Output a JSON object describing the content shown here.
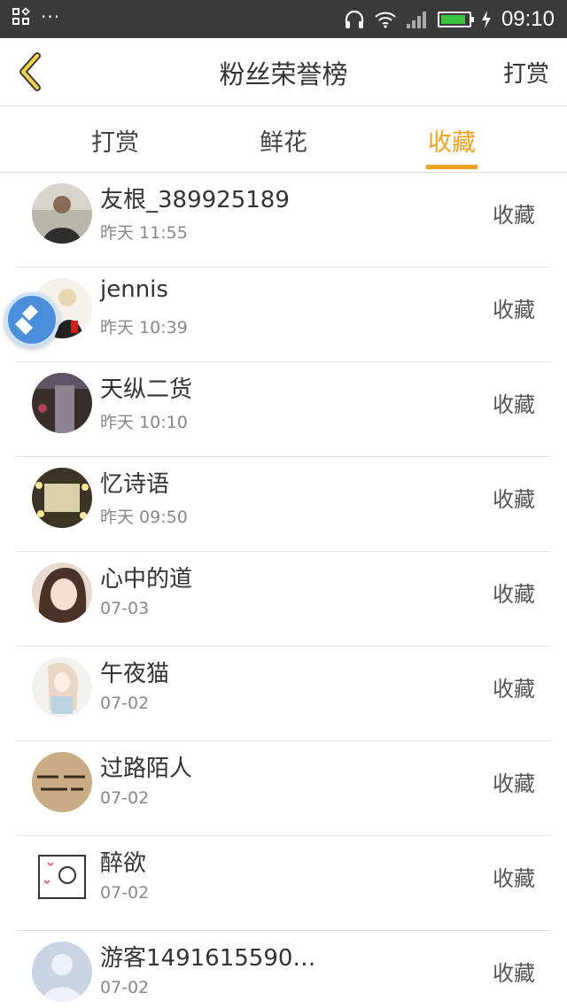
{
  "status_bar": {
    "time": "09:10",
    "dots": "···",
    "icons": [
      "grid-icon",
      "headphones-icon",
      "wifi-icon",
      "signal-icon",
      "battery-icon",
      "charging-icon"
    ],
    "battery_level": 0.9,
    "battery_color": "#3ec33e"
  },
  "header": {
    "back_icon": "chevron-left-icon",
    "title": "粉丝荣誉榜",
    "action": "打赏"
  },
  "tabs": [
    {
      "label": "打赏",
      "active": false
    },
    {
      "label": "鲜花",
      "active": false
    },
    {
      "label": "收藏",
      "active": true
    }
  ],
  "accent_color": "#f0a21f",
  "list": [
    {
      "name": "友根_389925189",
      "time": "昨天  11:55",
      "tag": "收藏"
    },
    {
      "name": "jennis",
      "time": "昨天  10:39",
      "tag": "收藏"
    },
    {
      "name": "天纵二货",
      "time": "昨天  10:10",
      "tag": "收藏"
    },
    {
      "name": "忆诗语",
      "time": "昨天  09:50",
      "tag": "收藏"
    },
    {
      "name": "心中的道",
      "time": "07-03",
      "tag": "收藏"
    },
    {
      "name": "午夜猫",
      "time": "07-02",
      "tag": "收藏"
    },
    {
      "name": "过路陌人",
      "time": "07-02",
      "tag": "收藏"
    },
    {
      "name": "醉欲",
      "time": "07-02",
      "tag": "收藏"
    },
    {
      "name": "游客1491615590…",
      "time": "07-02",
      "tag": "收藏"
    }
  ],
  "floating_button": {
    "icon": "broom-icon"
  }
}
